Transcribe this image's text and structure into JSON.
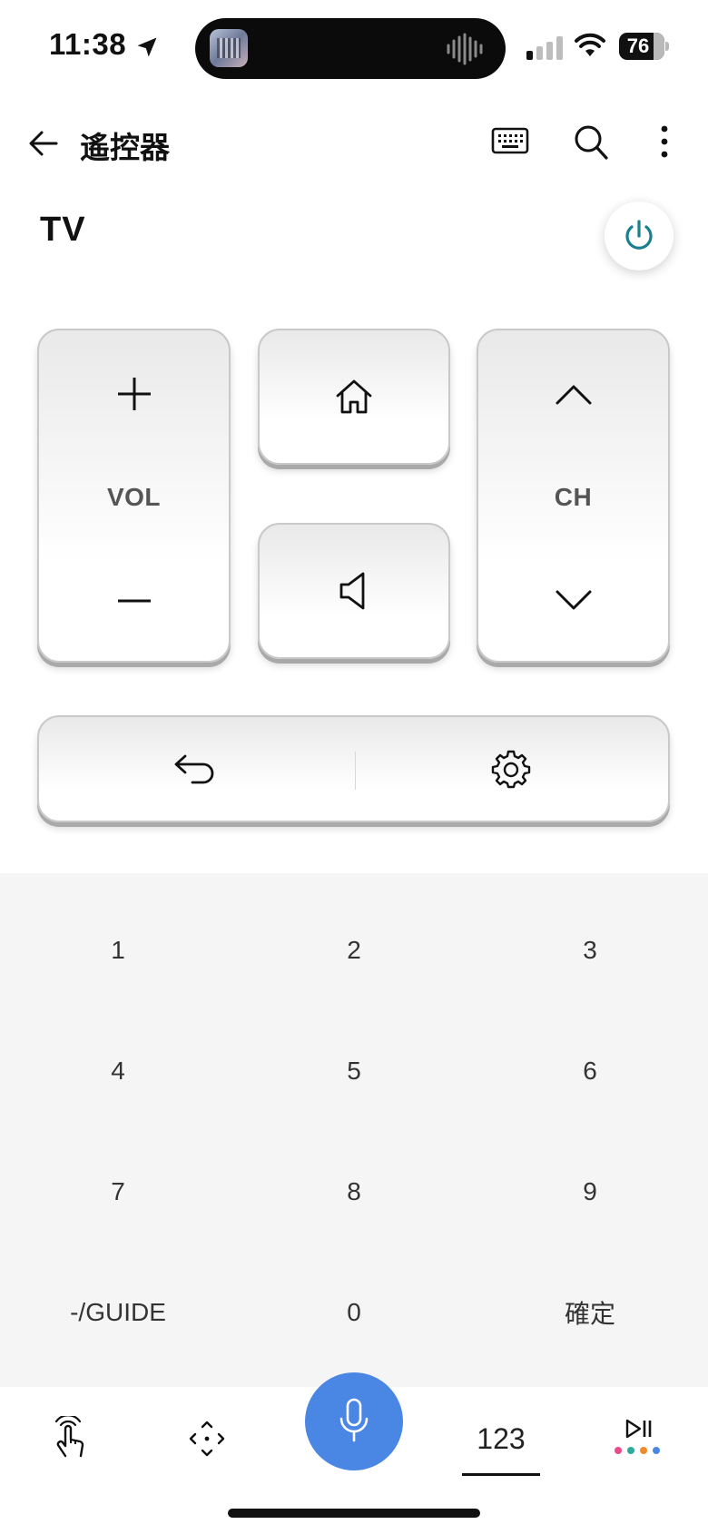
{
  "status_bar": {
    "time": "11:38",
    "battery": "76"
  },
  "app_bar": {
    "title": "遙控器"
  },
  "device": {
    "name": "TV"
  },
  "rocker": {
    "vol_label": "VOL",
    "ch_label": "CH"
  },
  "keypad": {
    "keys": [
      "1",
      "2",
      "3",
      "4",
      "5",
      "6",
      "7",
      "8",
      "9",
      "-/GUIDE",
      "0",
      "確定"
    ]
  },
  "bottom_nav": {
    "numbers_tab_label": "123"
  },
  "colors": {
    "accent": "#4a86e3",
    "power": "#1a7f8e",
    "keypad_bg": "#f5f5f5"
  }
}
